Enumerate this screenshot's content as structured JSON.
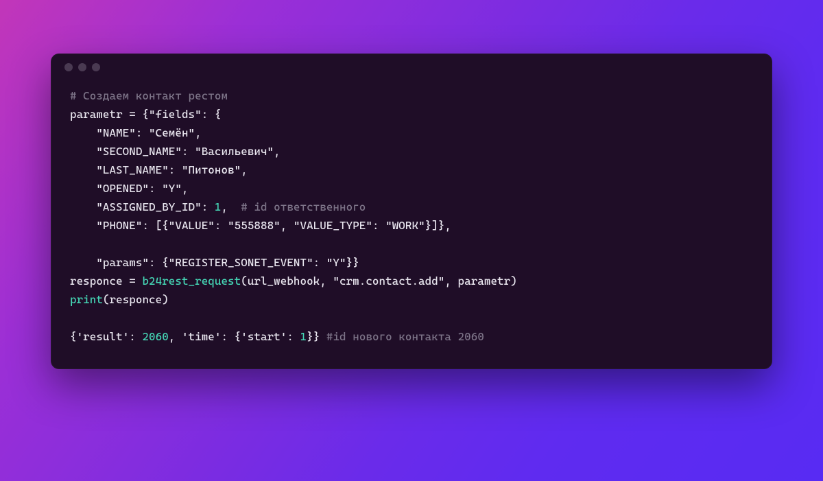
{
  "code": {
    "lines": [
      [
        {
          "cls": "tok-comment",
          "t": "# Создаем контакт рестом"
        }
      ],
      [
        {
          "cls": "tok-default",
          "t": "parametr = {"
        },
        {
          "cls": "tok-string",
          "t": "\"fields\""
        },
        {
          "cls": "tok-default",
          "t": ": {"
        }
      ],
      [
        {
          "cls": "tok-default",
          "t": "    "
        },
        {
          "cls": "tok-string",
          "t": "\"NAME\""
        },
        {
          "cls": "tok-default",
          "t": ": "
        },
        {
          "cls": "tok-string",
          "t": "\"Семён\""
        },
        {
          "cls": "tok-default",
          "t": ","
        }
      ],
      [
        {
          "cls": "tok-default",
          "t": "    "
        },
        {
          "cls": "tok-string",
          "t": "\"SECOND_NAME\""
        },
        {
          "cls": "tok-default",
          "t": ": "
        },
        {
          "cls": "tok-string",
          "t": "\"Васильевич\""
        },
        {
          "cls": "tok-default",
          "t": ","
        }
      ],
      [
        {
          "cls": "tok-default",
          "t": "    "
        },
        {
          "cls": "tok-string",
          "t": "\"LAST_NAME\""
        },
        {
          "cls": "tok-default",
          "t": ": "
        },
        {
          "cls": "tok-string",
          "t": "\"Питонов\""
        },
        {
          "cls": "tok-default",
          "t": ","
        }
      ],
      [
        {
          "cls": "tok-default",
          "t": "    "
        },
        {
          "cls": "tok-string",
          "t": "\"OPENED\""
        },
        {
          "cls": "tok-default",
          "t": ": "
        },
        {
          "cls": "tok-string",
          "t": "\"Y\""
        },
        {
          "cls": "tok-default",
          "t": ","
        }
      ],
      [
        {
          "cls": "tok-default",
          "t": "    "
        },
        {
          "cls": "tok-string",
          "t": "\"ASSIGNED_BY_ID\""
        },
        {
          "cls": "tok-default",
          "t": ": "
        },
        {
          "cls": "tok-number",
          "t": "1"
        },
        {
          "cls": "tok-default",
          "t": ",  "
        },
        {
          "cls": "tok-comment",
          "t": "# id ответственного"
        }
      ],
      [
        {
          "cls": "tok-default",
          "t": "    "
        },
        {
          "cls": "tok-string",
          "t": "\"PHONE\""
        },
        {
          "cls": "tok-default",
          "t": ": [{"
        },
        {
          "cls": "tok-string",
          "t": "\"VALUE\""
        },
        {
          "cls": "tok-default",
          "t": ": "
        },
        {
          "cls": "tok-string",
          "t": "\"555888\""
        },
        {
          "cls": "tok-default",
          "t": ", "
        },
        {
          "cls": "tok-string",
          "t": "\"VALUE_TYPE\""
        },
        {
          "cls": "tok-default",
          "t": ": "
        },
        {
          "cls": "tok-string",
          "t": "\"WORK\""
        },
        {
          "cls": "tok-default",
          "t": "}]},"
        }
      ],
      [
        {
          "cls": "tok-default",
          "t": ""
        }
      ],
      [
        {
          "cls": "tok-default",
          "t": "    "
        },
        {
          "cls": "tok-string",
          "t": "\"params\""
        },
        {
          "cls": "tok-default",
          "t": ": {"
        },
        {
          "cls": "tok-string",
          "t": "\"REGISTER_SONET_EVENT\""
        },
        {
          "cls": "tok-default",
          "t": ": "
        },
        {
          "cls": "tok-string",
          "t": "\"Y\""
        },
        {
          "cls": "tok-default",
          "t": "}}"
        }
      ],
      [
        {
          "cls": "tok-default",
          "t": "responce = "
        },
        {
          "cls": "tok-func",
          "t": "b24rest_request"
        },
        {
          "cls": "tok-default",
          "t": "(url_webhook, "
        },
        {
          "cls": "tok-string",
          "t": "\"crm.contact.add\""
        },
        {
          "cls": "tok-default",
          "t": ", parametr)"
        }
      ],
      [
        {
          "cls": "tok-func",
          "t": "print"
        },
        {
          "cls": "tok-default",
          "t": "(responce)"
        }
      ],
      [
        {
          "cls": "tok-default",
          "t": ""
        }
      ],
      [
        {
          "cls": "tok-default",
          "t": "{"
        },
        {
          "cls": "tok-string",
          "t": "'result'"
        },
        {
          "cls": "tok-default",
          "t": ": "
        },
        {
          "cls": "tok-number",
          "t": "2060"
        },
        {
          "cls": "tok-default",
          "t": ", "
        },
        {
          "cls": "tok-string",
          "t": "'time'"
        },
        {
          "cls": "tok-default",
          "t": ": {"
        },
        {
          "cls": "tok-string",
          "t": "'start'"
        },
        {
          "cls": "tok-default",
          "t": ": "
        },
        {
          "cls": "tok-number",
          "t": "1"
        },
        {
          "cls": "tok-default",
          "t": "}} "
        },
        {
          "cls": "tok-comment",
          "t": "#id нового контакта 2060"
        }
      ]
    ]
  }
}
